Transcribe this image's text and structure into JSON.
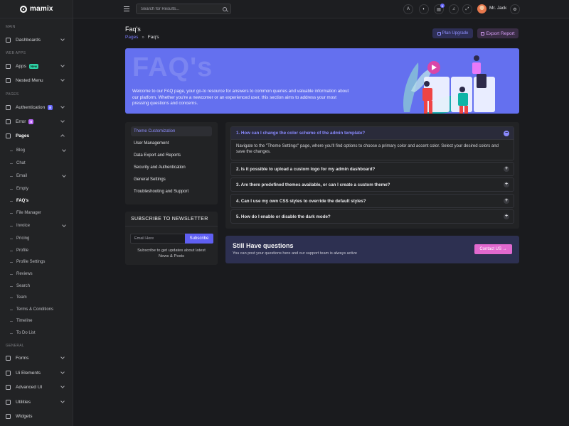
{
  "app": {
    "brand": "mamix"
  },
  "sidebar": {
    "groups": [
      "MAIN",
      "WEB APPS",
      "PAGES",
      "GENERAL"
    ],
    "items": [
      {
        "label": "Dashboards"
      },
      {
        "label": "Apps",
        "badge": "New"
      },
      {
        "label": "Nested Menu"
      },
      {
        "label": "Authentication",
        "badge": "8"
      },
      {
        "label": "Error",
        "badge": "8"
      },
      {
        "label": "Pages"
      },
      {
        "label": "Forms"
      },
      {
        "label": "Ui Elements"
      },
      {
        "label": "Advanced UI"
      },
      {
        "label": "Utilities"
      },
      {
        "label": "Widgets"
      }
    ],
    "sub_items": [
      "Blog",
      "Chat",
      "Email",
      "Empty",
      "FAQ's",
      "File Manager",
      "Invoice",
      "Pricing",
      "Profile",
      "Profile Settings",
      "Reviews",
      "Search",
      "Team",
      "Terms & Conditions",
      "Timeline",
      "To Do List"
    ]
  },
  "header": {
    "search_placeholder": "Search for Results...",
    "cart_count": "5",
    "user_name": "Mr. Jack"
  },
  "page": {
    "title": "Faq's",
    "breadcrumb": {
      "parent": "Pages",
      "current": "Faq's"
    },
    "btn_upgrade": "Plan Upgrade",
    "btn_export": "Export Report"
  },
  "banner": {
    "bg_text": "FAQ's",
    "text": "Welcome to our FAQ page, your go-to resource for answers to common queries and valuable information about our platform. Whether you're a newcomer or an experienced user, this section aims to address your most pressing questions and concerns."
  },
  "tabs": [
    "Theme Customization",
    "User Management",
    "Data Export and Reports",
    "Security and Authentication",
    "General Settings",
    "Troubleshooting and Support"
  ],
  "newsletter": {
    "title": "SUBSCRIBE TO NEWSLETTER",
    "placeholder": "Email Here",
    "button": "Subscribe",
    "note": "Subscribe to get updates about latest News & Posts"
  },
  "faqs": [
    {
      "q": "1. How can I change the color scheme of the admin template?",
      "a": "Navigate to the \"Theme Settings\" page, where you'll find options to choose a primary color and accent color. Select your desired colors and save the changes."
    },
    {
      "q": "2. Is it possible to upload a custom logo for my admin dashboard?"
    },
    {
      "q": "3. Are there predefined themes available, or can I create a custom theme?"
    },
    {
      "q": "4. Can I use my own CSS styles to override the default styles?"
    },
    {
      "q": "5. How do I enable or disable the dark mode?"
    }
  ],
  "cta": {
    "title": "Still Have questions",
    "subtitle": "You can post your questions here and our support team is always active",
    "button": "Contact US"
  },
  "colors": {
    "primary": "#5f5ff2",
    "banner": "#6470ef",
    "accent": "#e169cf"
  }
}
